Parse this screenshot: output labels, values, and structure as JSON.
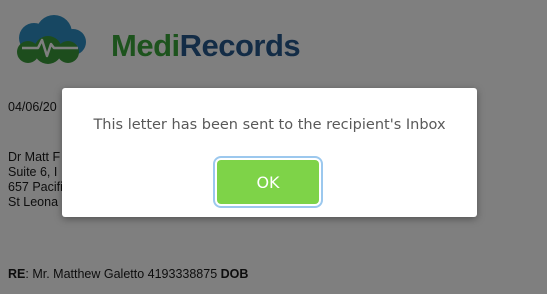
{
  "brand": {
    "medi": "Medi",
    "records": "Records",
    "logo_icon": "cloud-heartbeat-icon"
  },
  "letter": {
    "date": "04/06/20",
    "address_lines": [
      "Dr Matt F",
      "Suite 6, I",
      "657 Pacifi",
      "St Leona"
    ],
    "re_label": "RE",
    "re_text": ": Mr. Matthew Galetto 4193338875 ",
    "dob_label": "DOB"
  },
  "dialog": {
    "message": "This letter has been sent to the recipient's Inbox",
    "ok_label": "OK"
  },
  "colors": {
    "ok_button": "#7ed348",
    "brand_green": "#3aa63a",
    "brand_blue": "#27598d",
    "overlay": "rgba(0,0,0,0.5)"
  }
}
